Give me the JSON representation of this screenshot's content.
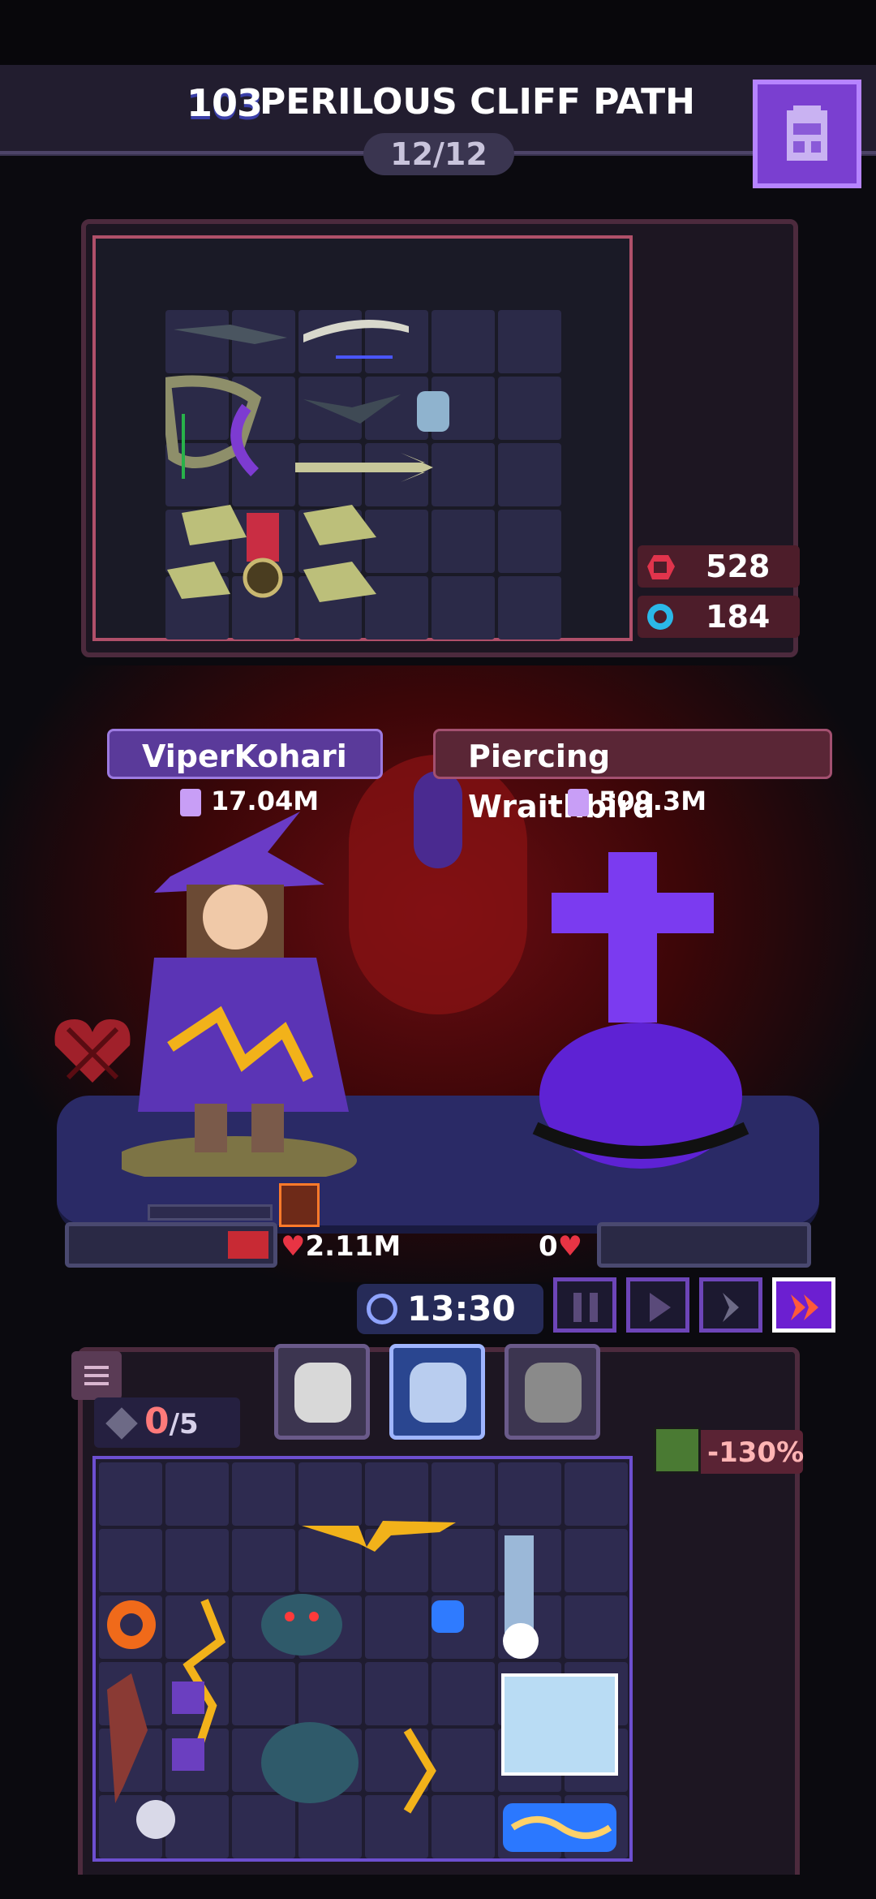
{
  "header": {
    "level_number": "103",
    "stage_name": "PERILOUS CLIFF PATH",
    "progress": "12/12",
    "backpack_icon": "backpack-icon"
  },
  "enemy_stats": {
    "attack": {
      "icon": "fist-icon",
      "value": "528",
      "color": "#e0344c"
    },
    "defense": {
      "icon": "gear-shield-icon",
      "value": "184",
      "color": "#2bb8e8"
    }
  },
  "player": {
    "name": "ViperKohari",
    "power": "17.04M",
    "hp": "2.11M"
  },
  "enemy": {
    "name": "Piercing Wraithbird",
    "power": "509.3M",
    "hp": "0"
  },
  "battle": {
    "timer": "13:30",
    "controls": [
      "pause",
      "play",
      "fast",
      "fastest"
    ],
    "active_speed": "fastest"
  },
  "inventory": {
    "slots_used": "0",
    "slots_total": "/5",
    "modifier": "-130%",
    "tabs": [
      "tab-ghost",
      "tab-wolf",
      "tab-cat"
    ],
    "active_tab": "tab-wolf"
  },
  "colors": {
    "accent_purple": "#7a3fd0",
    "enemy_red": "#5a2636",
    "player_purple": "#5a3a9a"
  }
}
